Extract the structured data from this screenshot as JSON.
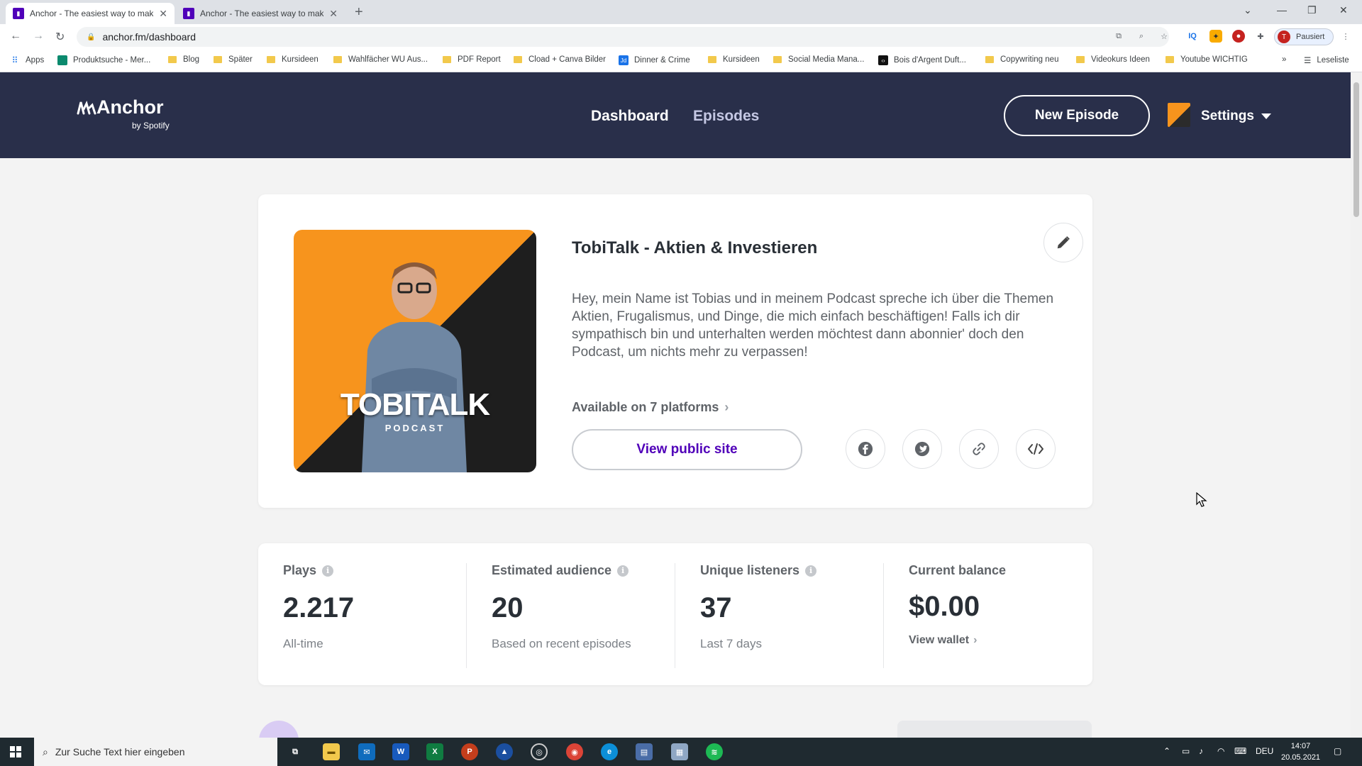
{
  "browser": {
    "tabs": [
      {
        "title": "Anchor - The easiest way to mak",
        "active": true
      },
      {
        "title": "Anchor - The easiest way to mak",
        "active": false
      }
    ],
    "url": "anchor.fm/dashboard",
    "profile_initial": "T",
    "profile_status": "Pausiert",
    "bookmarks": [
      "Apps",
      "Produktsuche - Mer...",
      "Blog",
      "Später",
      "Kursideen",
      "Wahlfächer WU Aus...",
      "PDF Report",
      "Cload + Canva Bilder",
      "Dinner & Crime",
      "Kursideen",
      "Social Media Mana...",
      "Bois d'Argent Duft...",
      "Copywriting neu",
      "Videokurs Ideen",
      "Youtube WICHTIG"
    ],
    "reading_list": "Leseliste",
    "more_bookmarks": "»"
  },
  "header": {
    "logo": "Anchor",
    "logo_sub": "by Spotify",
    "nav": [
      "Dashboard",
      "Episodes"
    ],
    "new_episode": "New Episode",
    "settings": "Settings",
    "bg_color": "#292f4a"
  },
  "podcast": {
    "cover_brand": "TOBITALK",
    "cover_sub": "PODCAST",
    "title": "TobiTalk - Aktien & Investieren",
    "description": "Hey, mein Name ist Tobias und in meinem Podcast spreche ich über die Themen Aktien, Frugalismus, und Dinge, die mich einfach beschäftigen! Falls ich dir sympathisch bin und unterhalten werden möchtest dann abonnier' doch den Podcast, um nichts mehr zu verpassen!",
    "platforms": "Available on 7 platforms",
    "view_public_site": "View public site",
    "accent_color": "#5000b9"
  },
  "stats": [
    {
      "label": "Plays",
      "value": "2.217",
      "sub": "All-time",
      "info": true
    },
    {
      "label": "Estimated audience",
      "value": "20",
      "sub": "Based on recent episodes",
      "info": true
    },
    {
      "label": "Unique listeners",
      "value": "37",
      "sub": "Last 7 days",
      "info": true
    },
    {
      "label": "Current balance",
      "value": "$0.00",
      "link": "View wallet",
      "info": false
    }
  ],
  "taskbar": {
    "search_placeholder": "Zur Suche Text hier eingeben",
    "language": "DEU",
    "time": "14:07",
    "date": "20.05.2021"
  }
}
